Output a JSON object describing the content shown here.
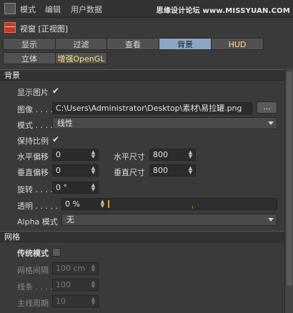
{
  "menubar": {
    "items": [
      "模式",
      "编辑",
      "用户数据"
    ],
    "watermark": "思缘设计论坛 www.MISSYUAN.COM"
  },
  "title": "视窗 [正视图]",
  "tabs_row1": [
    {
      "label": "显示",
      "active": false
    },
    {
      "label": "过滤",
      "active": false
    },
    {
      "label": "查看",
      "active": false
    },
    {
      "label": "背景",
      "active": true
    },
    {
      "label": "HUD",
      "active": false
    }
  ],
  "tabs_row2": [
    {
      "label": "立体",
      "active": false
    },
    {
      "label": "增强OpenGL",
      "active": false
    }
  ],
  "background_section": {
    "header": "背景",
    "show_image_label": "显示图片",
    "show_image_checked": "✔",
    "image_label": "图像 . . . .",
    "image_path": "C:\\Users\\Administrator\\Desktop\\素材\\易拉罐.png",
    "browse_button": "...",
    "mode_label": "模式 . . . .",
    "mode_value": "线性",
    "keep_ratio_label": "保持比例",
    "keep_ratio_checked": "✔",
    "h_offset_label": "水平偏移",
    "h_offset_value": "0",
    "h_size_label": "水平尺寸",
    "h_size_value": "800",
    "v_offset_label": "垂直偏移",
    "v_offset_value": "0",
    "v_size_label": "垂直尺寸",
    "v_size_value": "800",
    "rotate_label": "旋转 . . . .",
    "rotate_value": "0 °",
    "transparency_label": "透明 . . . . .",
    "transparency_value": "0 %",
    "alpha_label": "Alpha 模式",
    "alpha_value": "无"
  },
  "grid_section": {
    "header": "网格",
    "legacy_label": "传统模式",
    "spacing_label": "网格间隔",
    "spacing_value": "100 cm",
    "lines_label": "线条 . . . .",
    "lines_value": "100",
    "major_label": "主线周期",
    "major_value": "10"
  },
  "colors": {
    "active_tab": "#8aa6c4",
    "accent_slider": "#e0a22a",
    "panel_bg": "#3a3a3a"
  }
}
